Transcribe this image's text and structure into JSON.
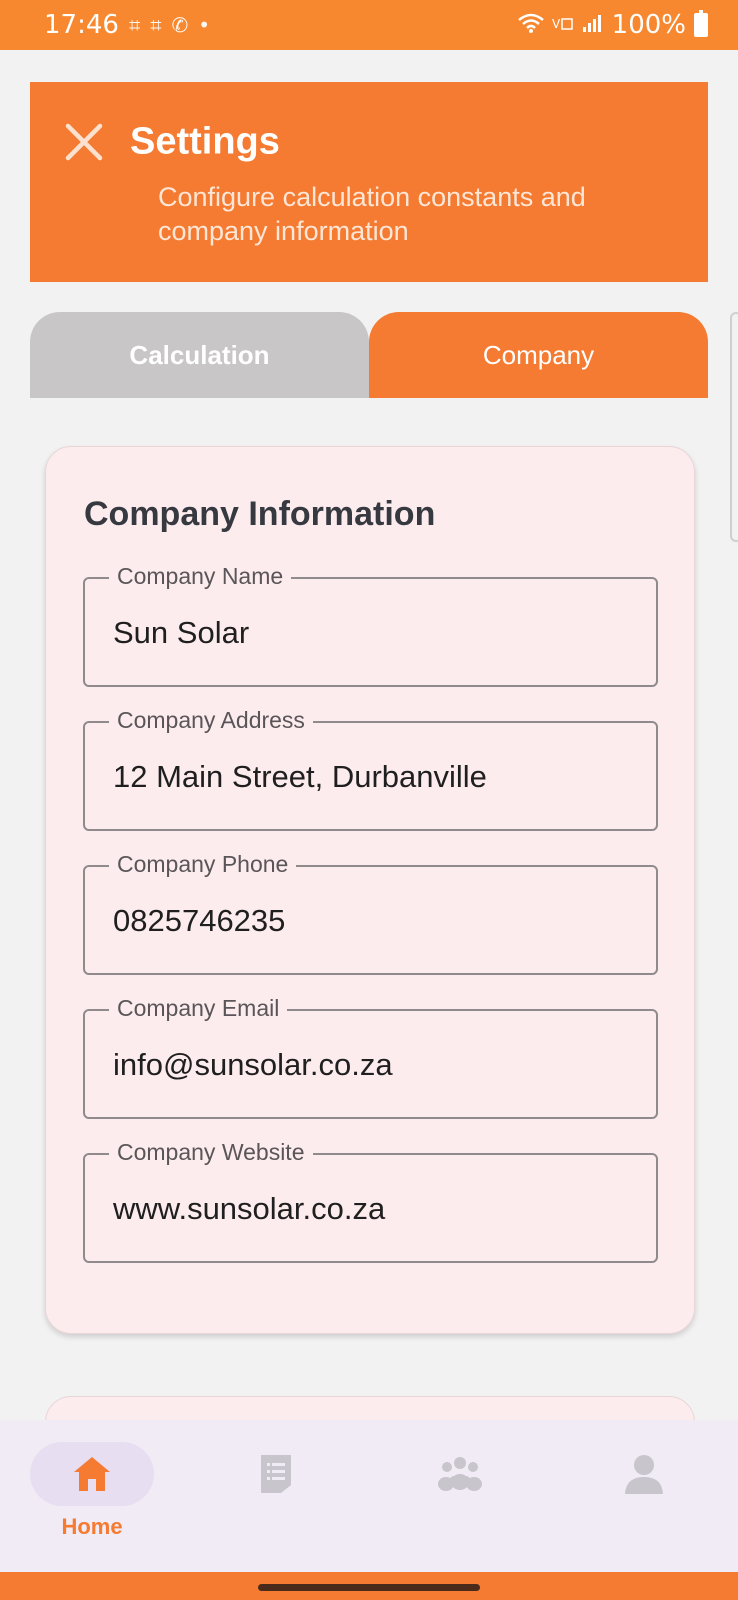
{
  "status_bar": {
    "time": "17:46",
    "battery": "100%"
  },
  "header": {
    "title": "Settings",
    "subtitle": "Configure calculation constants and company information"
  },
  "tabs": [
    {
      "label": "Calculation",
      "active": false
    },
    {
      "label": "Company",
      "active": true
    }
  ],
  "company_card": {
    "title": "Company Information",
    "fields": [
      {
        "label": "Company Name",
        "value": "Sun Solar"
      },
      {
        "label": "Company Address",
        "value": "12 Main Street, Durbanville"
      },
      {
        "label": "Company Phone",
        "value": "0825746235"
      },
      {
        "label": "Company Email",
        "value": "info@sunsolar.co.za"
      },
      {
        "label": "Company Website",
        "value": "www.sunsolar.co.za"
      }
    ]
  },
  "bottom_nav": {
    "items": [
      {
        "icon": "home-icon",
        "label": "Home",
        "active": true
      },
      {
        "icon": "document-icon",
        "label": "",
        "active": false
      },
      {
        "icon": "group-icon",
        "label": "",
        "active": false
      },
      {
        "icon": "person-icon",
        "label": "",
        "active": false
      }
    ]
  },
  "colors": {
    "accent": "#f47b31",
    "status_bar": "#f7882f",
    "inactive_tab": "#c8c6c6",
    "card_bg": "#fdecee",
    "nav_bg": "#f1ebf5"
  }
}
